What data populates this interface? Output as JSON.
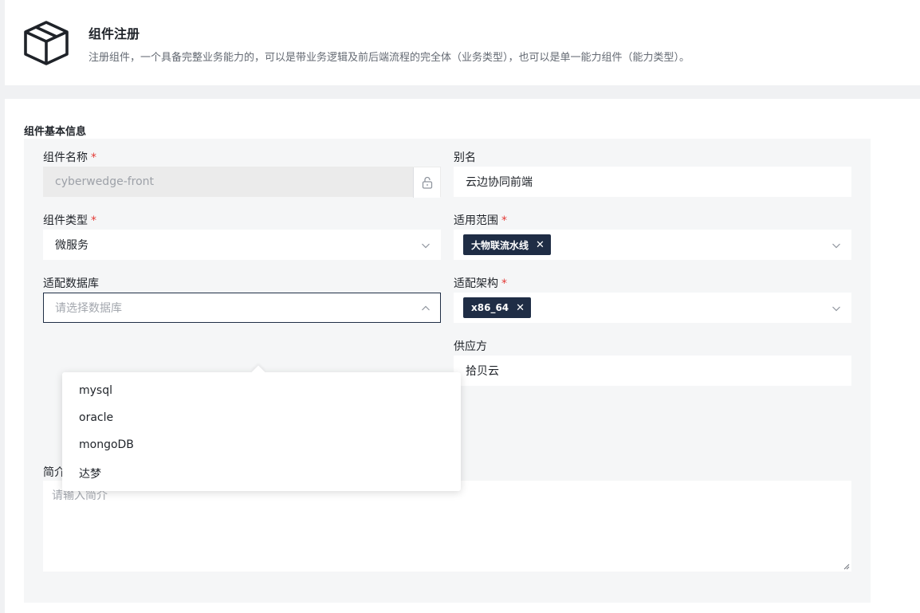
{
  "header": {
    "icon": "box-icon",
    "title": "组件注册",
    "description": "注册组件，一个具备完整业务能力的，可以是带业务逻辑及前后端流程的完全体（业务类型），也可以是单一能力组件（能力类型）。"
  },
  "section": {
    "title": "组件基本信息"
  },
  "form": {
    "required_mark": "*",
    "name": {
      "label": "组件名称",
      "value": "cyberwedge-front",
      "required": true,
      "disabled": true,
      "icon": "lock-icon"
    },
    "alias": {
      "label": "别名",
      "value": "云边协同前端"
    },
    "type": {
      "label": "组件类型",
      "value": "微服务",
      "required": true
    },
    "scope": {
      "label": "适用范围",
      "tags": [
        "大物联流水线"
      ],
      "required": true
    },
    "database": {
      "label": "适配数据库",
      "placeholder": "请选择数据库",
      "open": true
    },
    "arch": {
      "label": "适配架构",
      "tags": [
        "x86_64"
      ],
      "required": true
    },
    "supplier": {
      "label": "供应方",
      "value": "拾贝云"
    },
    "intro": {
      "label": "简介",
      "placeholder": "请输入简介"
    }
  },
  "dropdown": {
    "options": [
      "mysql",
      "oracle",
      "mongoDB",
      "达梦"
    ]
  },
  "colors": {
    "tag_bg": "#1f2d45",
    "required": "#e33a35",
    "panel_bg": "#f5f6f7",
    "focus_border": "#1f2e45"
  }
}
